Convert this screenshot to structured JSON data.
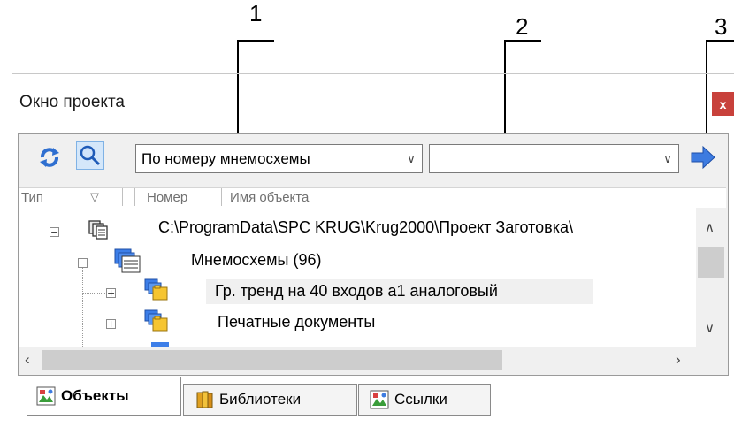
{
  "callouts": [
    "1",
    "2",
    "3"
  ],
  "window": {
    "title": "Окно проекта",
    "close_label": "x"
  },
  "toolbar": {
    "filter_select": {
      "value": "По номеру мнемосхемы"
    },
    "search_combo": {
      "value": ""
    },
    "icons": [
      "refresh-icon",
      "search-icon",
      "arrow-right-icon"
    ]
  },
  "columns": [
    "Тип",
    "Номер",
    "Имя объекта"
  ],
  "tree": [
    {
      "label": "C:\\ProgramData\\SPC KRUG\\Krug2000\\Проект Заготовка\\",
      "expander": "−"
    },
    {
      "label": "Мнемосхемы (96)",
      "expander": "−"
    },
    {
      "label": "Гр. тренд на 40 входов а1 аналоговый",
      "expander": "+"
    },
    {
      "label": "Печатные документы",
      "expander": "+"
    }
  ],
  "tabs": [
    {
      "label": "Объекты",
      "active": true
    },
    {
      "label": "Библиотеки",
      "active": false
    },
    {
      "label": "Ссылки",
      "active": false
    }
  ],
  "colors": {
    "close": "#c8413b",
    "arrow": "#3d7be0",
    "selected_row": "#f0f0f0"
  }
}
